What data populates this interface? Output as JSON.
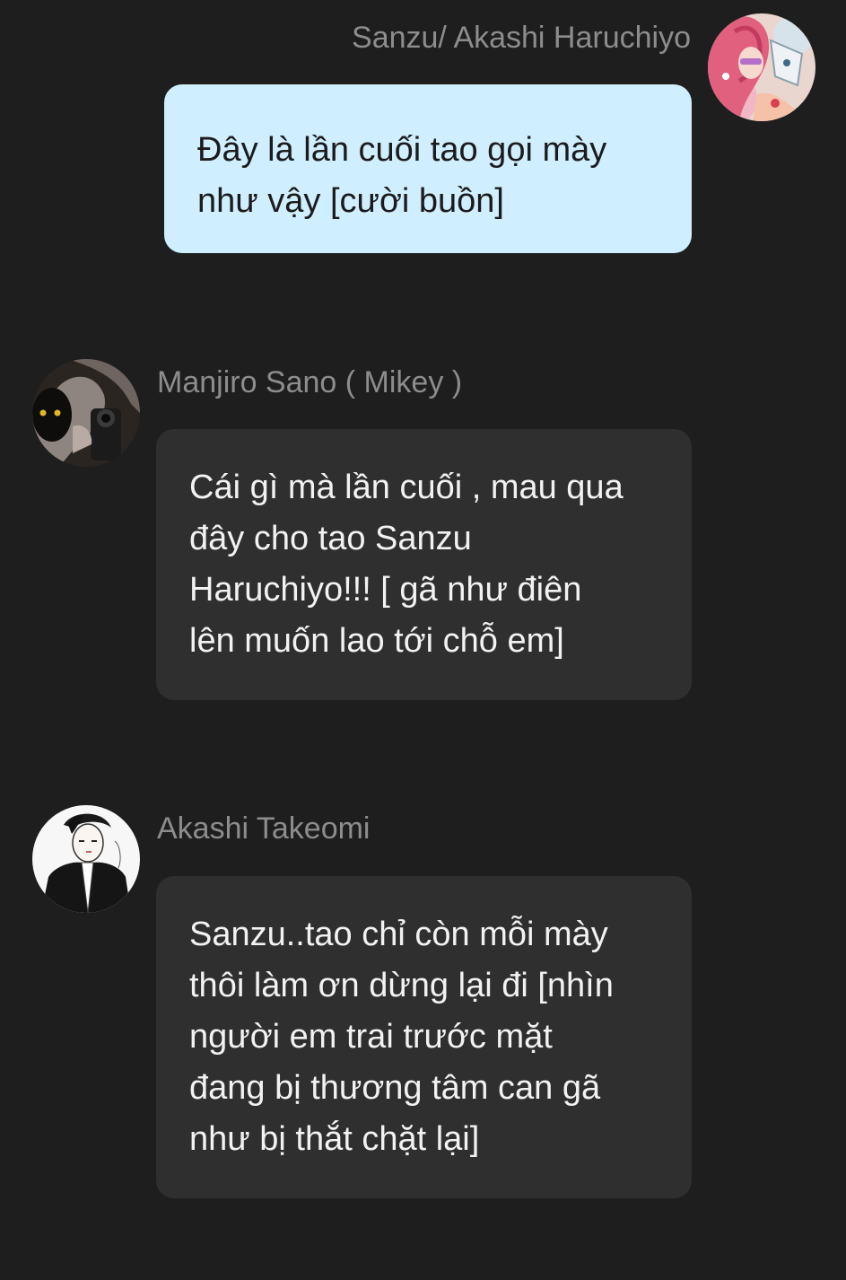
{
  "messages": [
    {
      "sender": "Sanzu/ Akashi Haruchiyo",
      "text": "Đây là lần cuối tao gọi mày\nnhư vậy [cười buồn]",
      "avatar_icon": "pink-hair-character-avatar-icon",
      "side": "self"
    },
    {
      "sender": "Manjiro Sano ( Mikey  )",
      "text": "Cái gì mà lần cuối , mau qua\nđây cho tao Sanzu\nHaruchiyo!!! [ gã như điên\nlên muốn lao tới chỗ em]",
      "avatar_icon": "cat-with-gun-avatar-icon",
      "side": "other"
    },
    {
      "sender": "Akashi Takeomi",
      "text": "Sanzu..tao chỉ còn mỗi mày\nthôi làm ơn dừng lại đi [nhìn\nngười em trai trước mặt\nđang bị thương tâm can gã\nnhư bị thắt chặt lại]",
      "avatar_icon": "suited-man-sketch-avatar-icon",
      "side": "other"
    }
  ],
  "colors": {
    "background": "#1e1e1e",
    "self_bubble": "#cfeeff",
    "other_bubble": "#2f2f2f",
    "name_text": "#8d8d8d"
  }
}
